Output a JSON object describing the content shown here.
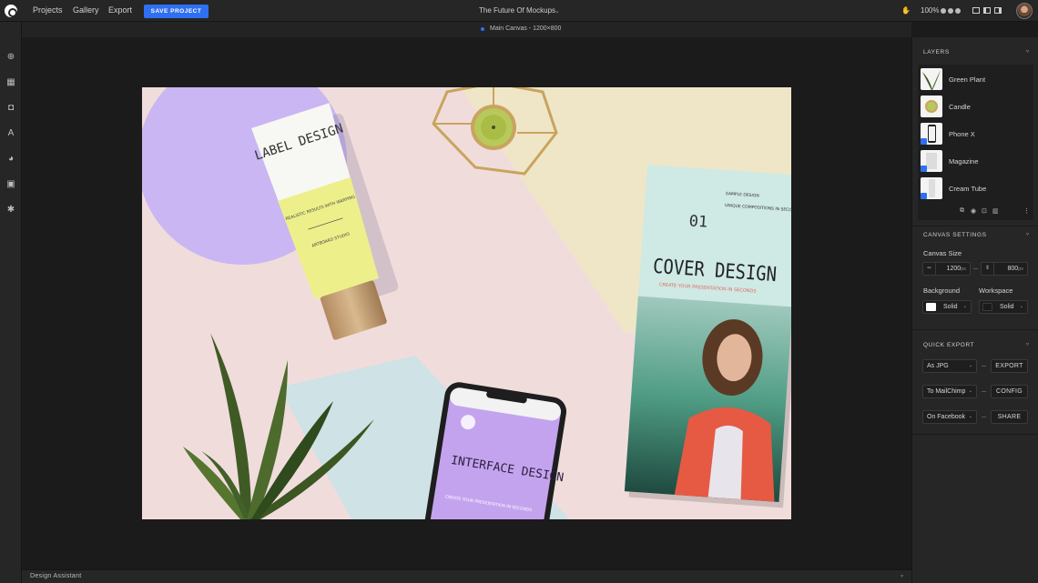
{
  "topbar": {
    "nav": [
      "Projects",
      "Gallery",
      "Export"
    ],
    "save_label": "SAVE PROJECT",
    "project_title": "The Future Of Mockups",
    "zoom": "100%"
  },
  "subbar": {
    "label": "Main Canvas - 1200×800"
  },
  "bottombar": {
    "label": "Design Assistant"
  },
  "mockup": {
    "tube_title": "LABEL DESIGN",
    "tube_sub": "REALISTIC RESULTS WITH WARPING",
    "tube_foot": "ARTBOARD STUDIO",
    "magazine_kicker": "SAMPLE DESIGN",
    "magazine_tagline": "UNIQUE COMPOSITIONS IN SECONDS FROM BROWSER",
    "magazine_number": "01",
    "magazine_title": "COVER DESIGN",
    "magazine_sub": "CREATE YOUR PRESENTATION IN SECONDS",
    "phone_title": "INTERFACE DESIGN",
    "phone_sub": "CREATE YOUR PRESENTATION IN SECONDS"
  },
  "layers": {
    "title": "LAYERS",
    "items": [
      "Green Plant",
      "Candle",
      "Phone X",
      "Magazine",
      "Cream Tube"
    ]
  },
  "canvas_settings": {
    "title": "CANVAS SETTINGS",
    "size_label": "Canvas Size",
    "width": "1200",
    "height": "800",
    "unit": "px",
    "background_label": "Background",
    "workspace_label": "Workspace",
    "background_value": "Solid",
    "workspace_value": "Solid",
    "background_color": "#ffffff",
    "workspace_color": "#1b1b1b"
  },
  "quick_export": {
    "title": "QUICK EXPORT",
    "rows": [
      {
        "option": "As JPG",
        "action": "EXPORT"
      },
      {
        "option": "To MailChimp",
        "action": "CONFIG"
      },
      {
        "option": "On Facebook",
        "action": "SHARE"
      }
    ]
  },
  "colors": {
    "accent": "#2f6ff2",
    "panel": "#262626",
    "workspace": "#1b1b1b"
  }
}
